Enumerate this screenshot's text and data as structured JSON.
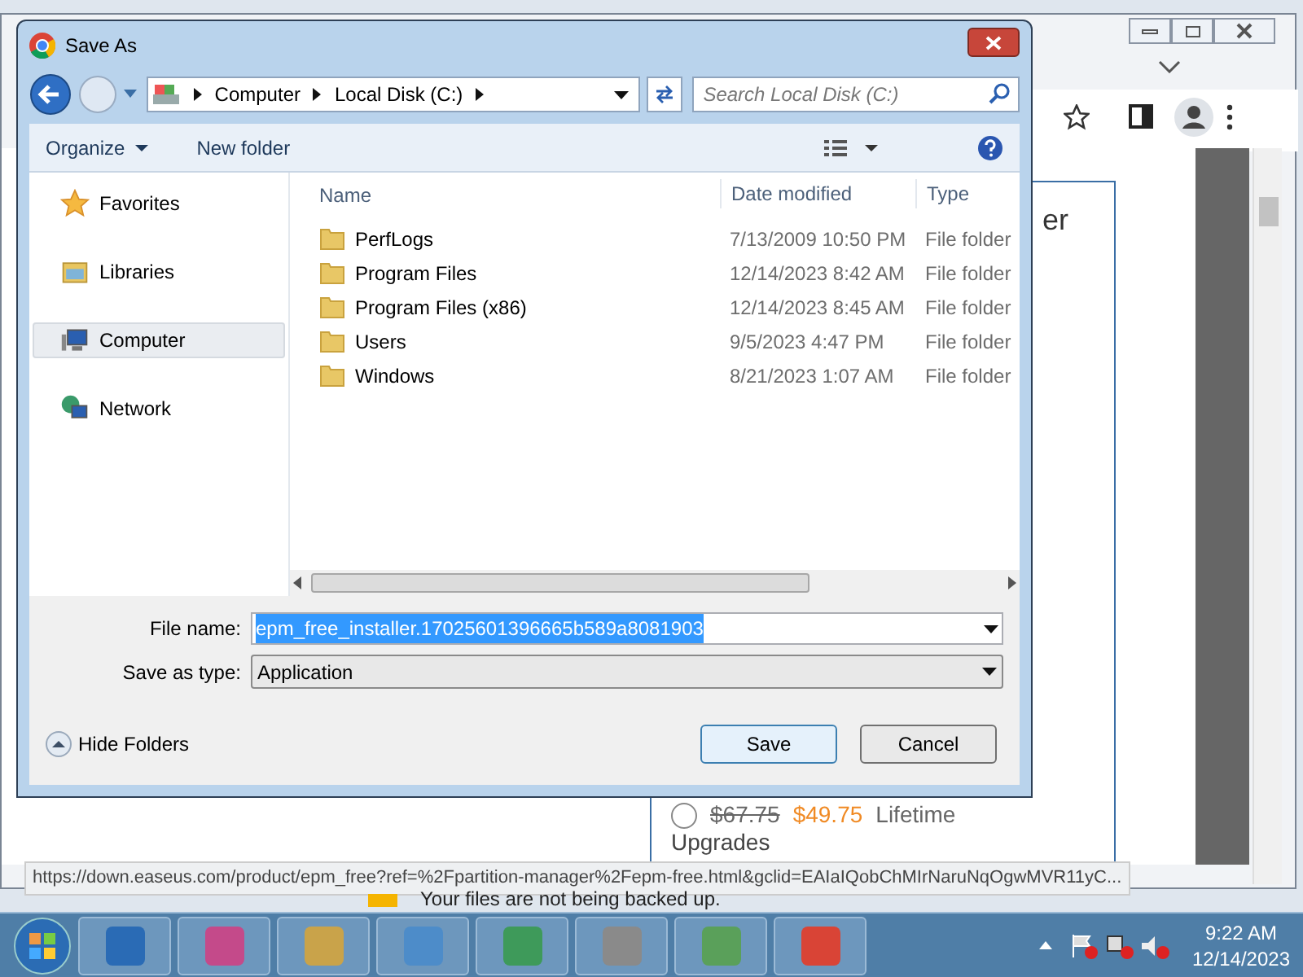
{
  "dialog": {
    "title": "Save As",
    "address": {
      "crumbs": [
        "Computer",
        "Local Disk (C:)"
      ]
    },
    "search": {
      "placeholder": "Search Local Disk (C:)"
    },
    "toolbar": {
      "organize": "Organize",
      "new_folder": "New folder"
    },
    "nav_items": [
      {
        "label": "Favorites",
        "kind": "favorites",
        "selected": false
      },
      {
        "label": "Libraries",
        "kind": "libraries",
        "selected": false
      },
      {
        "label": "Computer",
        "kind": "computer",
        "selected": true
      },
      {
        "label": "Network",
        "kind": "network",
        "selected": false
      }
    ],
    "columns": [
      "Name",
      "Date modified",
      "Type"
    ],
    "rows": [
      {
        "name": "PerfLogs",
        "date": "7/13/2009 10:50 PM",
        "type": "File folder"
      },
      {
        "name": "Program Files",
        "date": "12/14/2023 8:42 AM",
        "type": "File folder"
      },
      {
        "name": "Program Files (x86)",
        "date": "12/14/2023 8:45 AM",
        "type": "File folder"
      },
      {
        "name": "Users",
        "date": "9/5/2023 4:47 PM",
        "type": "File folder"
      },
      {
        "name": "Windows",
        "date": "8/21/2023 1:07 AM",
        "type": "File folder"
      }
    ],
    "file_name": {
      "label": "File name:",
      "value": "epm_free_installer.17025601396665b589a8081903"
    },
    "save_type": {
      "label": "Save as type:",
      "value": "Application"
    },
    "hide_folders": "Hide Folders",
    "buttons": [
      "Save",
      "Cancel"
    ]
  },
  "browser": {
    "heading_fragment": "er",
    "radio_selected": false,
    "price_old": "$67.75",
    "price_new": "$49.75",
    "price_term": "Lifetime",
    "upgrades": "Upgrades",
    "notice": "Your files are not being backed up.",
    "status_url": "https://down.easeus.com/product/epm_free?ref=%2Fpartition-manager%2Fepm-free.html&gclid=EAIaIQobChMIrNaruNqOgwMVR11yC..."
  },
  "taskbar": {
    "time": "9:22 AM",
    "date": "12/14/2023"
  }
}
